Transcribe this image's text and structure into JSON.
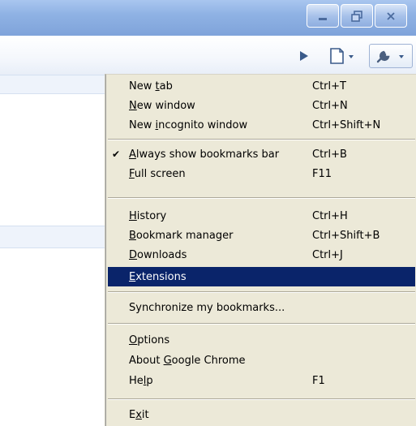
{
  "window": {
    "controls": [
      "minimize",
      "restore",
      "close"
    ]
  },
  "toolbar": {
    "icons": [
      "play-icon",
      "page-menu-icon",
      "wrench-menu-icon"
    ]
  },
  "menu": {
    "items": [
      {
        "label": "New tab",
        "mnemonic": "t",
        "shortcut": "Ctrl+T"
      },
      {
        "label": "New window",
        "mnemonic": "N",
        "shortcut": "Ctrl+N"
      },
      {
        "label": "New incognito window",
        "mnemonic": "i",
        "shortcut": "Ctrl+Shift+N"
      },
      {
        "label": "Always show bookmarks bar",
        "mnemonic": "A",
        "shortcut": "Ctrl+B",
        "checked": true
      },
      {
        "label": "Full screen",
        "mnemonic": "F",
        "shortcut": "F11"
      },
      {
        "label": "History",
        "mnemonic": "H",
        "shortcut": "Ctrl+H"
      },
      {
        "label": "Bookmark manager",
        "mnemonic": "B",
        "shortcut": "Ctrl+Shift+B"
      },
      {
        "label": "Downloads",
        "mnemonic": "D",
        "shortcut": "Ctrl+J"
      },
      {
        "label": "Extensions",
        "mnemonic": "E",
        "shortcut": "",
        "selected": true
      },
      {
        "label": "Synchronize my bookmarks...",
        "mnemonic": "",
        "shortcut": ""
      },
      {
        "label": "Options",
        "mnemonic": "O",
        "shortcut": ""
      },
      {
        "label": "About Google Chrome",
        "mnemonic": "G",
        "shortcut": ""
      },
      {
        "label": "Help",
        "mnemonic": "l",
        "shortcut": "F1"
      },
      {
        "label": "Exit",
        "mnemonic": "x",
        "shortcut": ""
      }
    ]
  },
  "colors": {
    "menu_bg": "#ece9d8",
    "selection_bg": "#0a246a",
    "title_bar": "#8fb2e4"
  }
}
